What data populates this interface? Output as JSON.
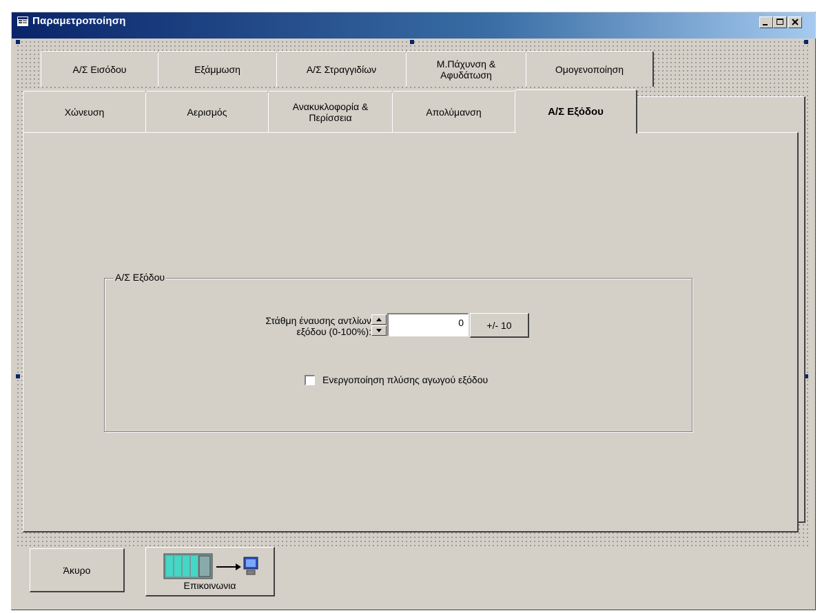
{
  "window": {
    "title": "Παραμετροποίηση"
  },
  "tabs_row1": [
    {
      "label": "Α/Σ Εισόδου"
    },
    {
      "label": "Εξάμμωση"
    },
    {
      "label": "Α/Σ Στραγγιδίων"
    },
    {
      "label": "Μ.Πάχυνση &\nΑφυδάτωση"
    },
    {
      "label": "Ομογενοποίηση"
    }
  ],
  "tabs_row2": [
    {
      "label": "Χώνευση"
    },
    {
      "label": "Αερισμός"
    },
    {
      "label": "Ανακυκλοφορία &\nΠερίσσεια"
    },
    {
      "label": "Απολύμανση"
    },
    {
      "label": "Α/Σ Εξόδου",
      "active": true
    }
  ],
  "panel": {
    "group_title": "Α/Σ Εξόδου",
    "level_label": "Στάθμη έναυσης αντλίων\nεξόδου (0-100%):",
    "level_value": "0",
    "step_button": "+/- 10",
    "checkbox_label": "Ενεργοποίηση πλύσης αγωγού εξόδου",
    "checkbox_checked": false
  },
  "buttons": {
    "cancel": "Άκυρο",
    "communication": "Επικοινωνια"
  },
  "icons": {
    "title": "form-icon",
    "communication": "plc-to-computer-icon"
  },
  "colors": {
    "face": "#d4d0c8",
    "title_start": "#0a246a",
    "title_end": "#a6caf0"
  }
}
